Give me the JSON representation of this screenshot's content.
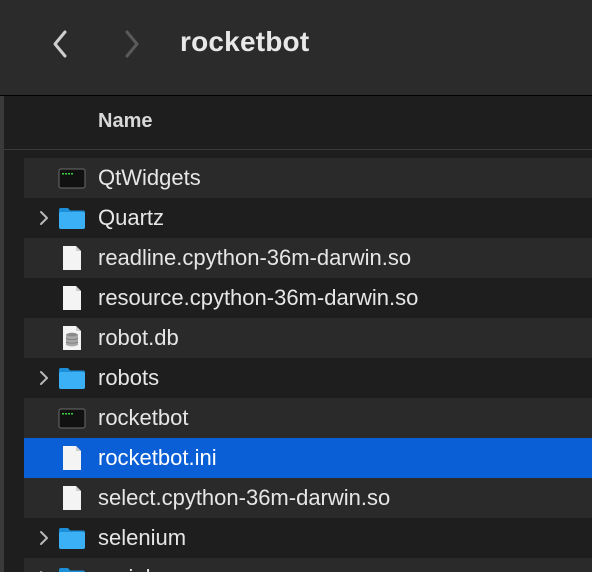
{
  "toolbar": {
    "title": "rocketbot",
    "back_icon": "chevron-left-icon",
    "forward_icon": "chevron-right-icon"
  },
  "columns": {
    "name": "Name"
  },
  "colors": {
    "selection": "#0a5fd6",
    "folder": "#2aa6f0",
    "row_alt": "#2a2a2a",
    "background": "#1e1e1e"
  },
  "files": [
    {
      "name": "QtWidgets",
      "kind": "executable",
      "icon": "terminal-exec-icon",
      "expandable": false
    },
    {
      "name": "Quartz",
      "kind": "folder",
      "icon": "folder-icon",
      "expandable": true
    },
    {
      "name": "readline.cpython-36m-darwin.so",
      "kind": "document",
      "icon": "document-icon",
      "expandable": false
    },
    {
      "name": "resource.cpython-36m-darwin.so",
      "kind": "document",
      "icon": "document-icon",
      "expandable": false
    },
    {
      "name": "robot.db",
      "kind": "database",
      "icon": "database-icon",
      "expandable": false
    },
    {
      "name": "robots",
      "kind": "folder",
      "icon": "folder-icon",
      "expandable": true
    },
    {
      "name": "rocketbot",
      "kind": "executable",
      "icon": "terminal-exec-icon",
      "expandable": false
    },
    {
      "name": "rocketbot.ini",
      "kind": "document",
      "icon": "document-icon",
      "expandable": false,
      "selected": true
    },
    {
      "name": "select.cpython-36m-darwin.so",
      "kind": "document",
      "icon": "document-icon",
      "expandable": false
    },
    {
      "name": "selenium",
      "kind": "folder",
      "icon": "folder-icon",
      "expandable": true
    },
    {
      "name": "serial",
      "kind": "folder",
      "icon": "folder-icon",
      "expandable": true
    }
  ]
}
